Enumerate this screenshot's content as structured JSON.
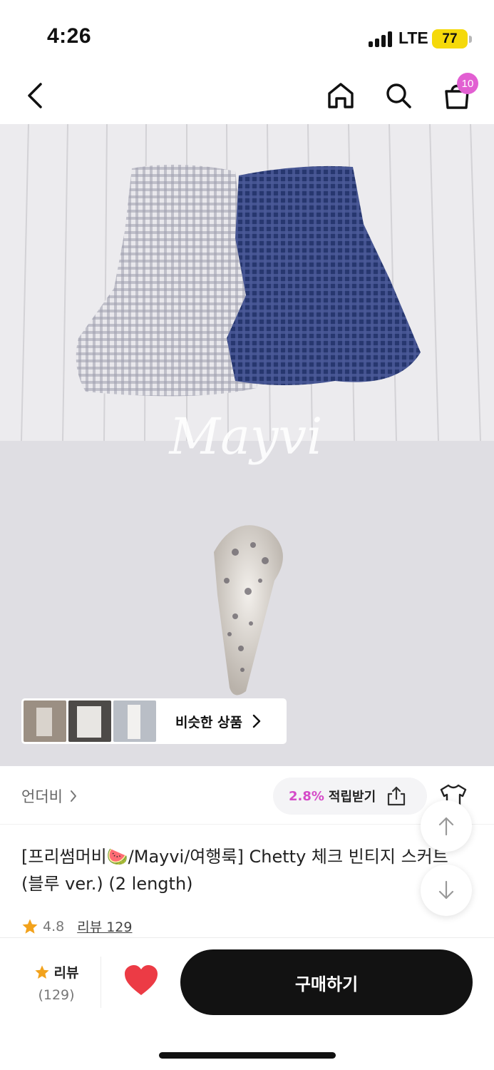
{
  "status": {
    "time": "4:26",
    "network": "LTE",
    "battery": "77"
  },
  "header": {
    "cart_count": "10",
    "icons": [
      "back-icon",
      "home-icon",
      "search-icon",
      "cart-icon"
    ]
  },
  "hero": {
    "watermark": "Mayvi",
    "similar_label": "비슷한 상품"
  },
  "brand": {
    "name": "언더비",
    "reward_percent": "2.8%",
    "reward_label": "적립받기"
  },
  "product": {
    "title": "[프리썸머비🍉/Mayvi/여행룩] Chetty 체크 빈티지 스커트 (블루 ver.) (2 length)",
    "rating": "4.8",
    "review_link": "리뷰 129"
  },
  "bottom_bar": {
    "review_label": "리뷰",
    "review_count": "(129)",
    "buy_label": "구매하기"
  },
  "colors": {
    "accent": "#e25fd2",
    "reward_pink": "#d54bc8",
    "star": "#f2a21c",
    "heart": "#ec3b45",
    "buy_button": "#121212",
    "battery": "#f5d90a"
  }
}
